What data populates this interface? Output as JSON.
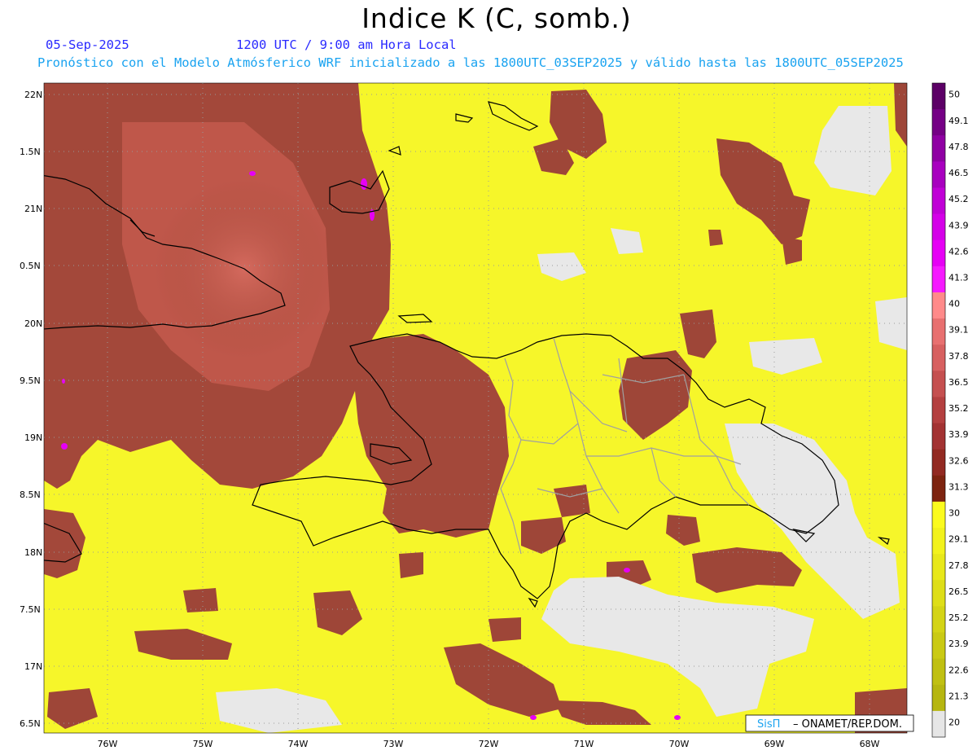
{
  "title": "Indice K (C, somb.)",
  "date": "05-Sep-2025",
  "time": "1200 UTC / 9:00 am Hora Local",
  "model_line": "Pronóstico con el Modelo Atmósferico WRF inicializado a las 1800UTC_03SEP2025 y válido hasta las  1800UTC_05SEP2025",
  "credit": {
    "brand": "SisΠ",
    "text": "– ONAMET/REP.DOM."
  },
  "colors": {
    "date_text": "#2a2aff",
    "model_text": "#1aa3f0",
    "land_outline": "#000000",
    "province_outline": "#a0a0a0",
    "grid": "#9a9a9a"
  },
  "map": {
    "lat_ticks": [
      "22N",
      "1.5N",
      "21N",
      "0.5N",
      "20N",
      "9.5N",
      "19N",
      "8.5N",
      "18N",
      "7.5N",
      "17N",
      "6.5N"
    ],
    "lon_ticks": [
      "76W",
      "75W",
      "74W",
      "73W",
      "72W",
      "71W",
      "70W",
      "69W",
      "68W"
    ]
  },
  "colorbar": {
    "labels": [
      "50",
      "49.1",
      "47.8",
      "46.5",
      "45.2",
      "43.9",
      "42.6",
      "41.3",
      "40",
      "39.1",
      "37.8",
      "36.5",
      "35.2",
      "33.9",
      "32.6",
      "31.3",
      "30",
      "29.1",
      "27.8",
      "26.5",
      "25.2",
      "23.9",
      "22.6",
      "21.3",
      "20"
    ],
    "colors": [
      "#5c0066",
      "#750085",
      "#8f00a3",
      "#a800bf",
      "#c000d6",
      "#d400e8",
      "#e600f5",
      "#f51aff",
      "#ff8a8a",
      "#e87070",
      "#d76060",
      "#c55050",
      "#b44040",
      "#a33333",
      "#922a22",
      "#7d2410",
      "#fbfb1e",
      "#f2f21c",
      "#e8e81a",
      "#dede18",
      "#d4d416",
      "#caca14",
      "#c0c012",
      "#b6b610",
      "#e6e6e6"
    ]
  },
  "chart_data": {
    "type": "heatmap",
    "title": "Indice K (C, somb.)",
    "units": "C",
    "color_scale_min": 20,
    "color_scale_max": 50,
    "lat_range": [
      "16.4N",
      "22.1N"
    ],
    "lon_range": [
      "76.6W",
      "67.6W"
    ],
    "regions": [
      {
        "area": "Cuba (east) and surrounding waters",
        "value_range": [
          33,
          39
        ]
      },
      {
        "area": "Haiti and western Hispaniola",
        "value_range": [
          31,
          36
        ]
      },
      {
        "area": "Dominican Republic interior",
        "value_range": [
          25,
          29
        ]
      },
      {
        "area": "northeast Dominican Republic",
        "value_range": [
          31,
          35
        ]
      },
      {
        "area": "eastern Dominican Republic and southern sea",
        "value_range": [
          20,
          22
        ]
      },
      {
        "area": "open Caribbean Sea",
        "value_range": [
          24,
          29
        ]
      },
      {
        "area": "Atlantic Ocean north",
        "value_range": [
          25,
          29
        ]
      }
    ],
    "max_value": 44
  }
}
